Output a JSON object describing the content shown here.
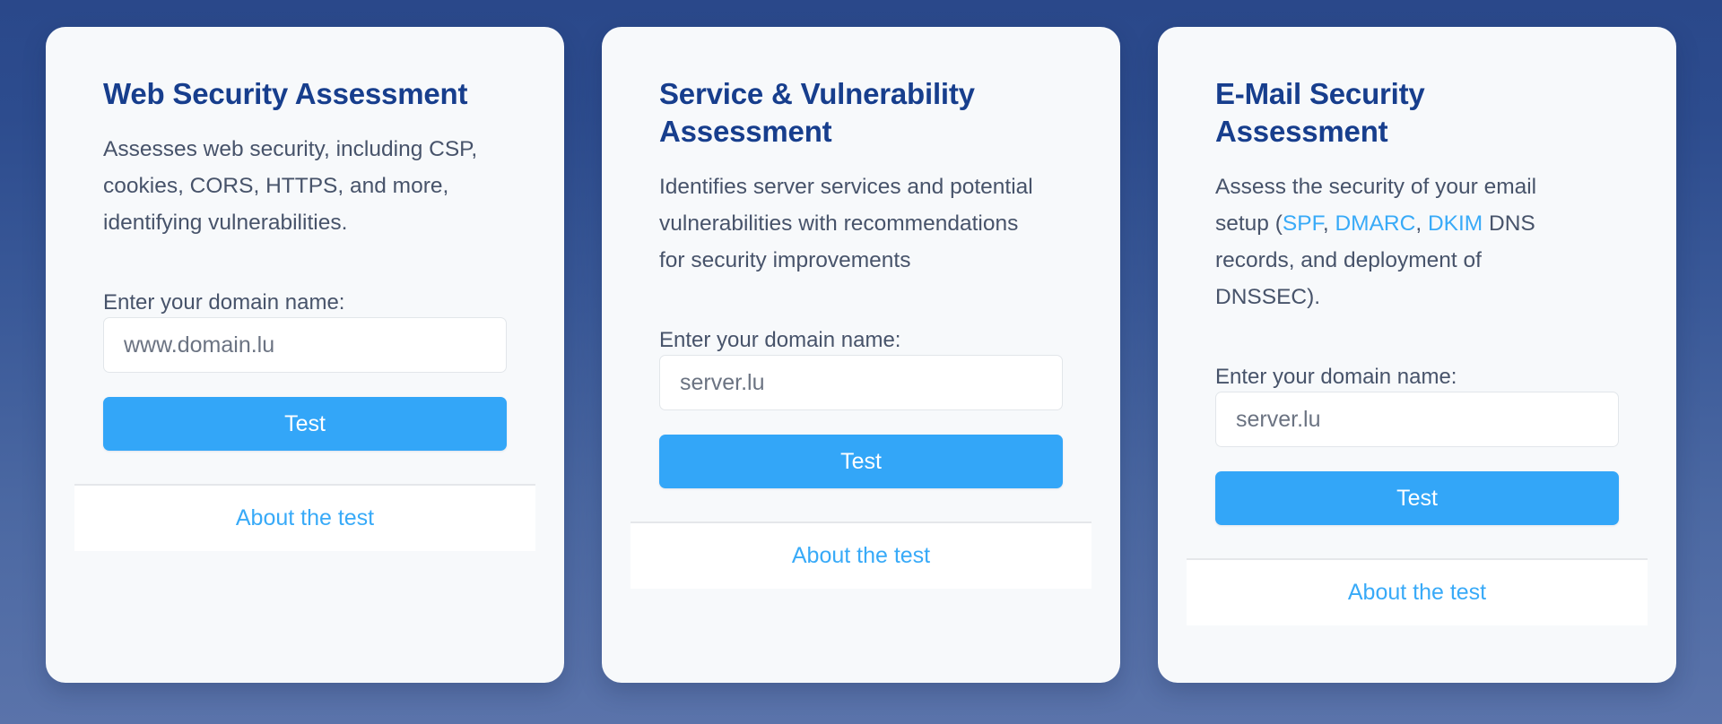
{
  "theme": {
    "background_top": "#2a488a",
    "background_bottom": "#5a73aa",
    "card_background": "#f7f9fb",
    "title_color": "#173e8d",
    "body_text_color": "#47536a",
    "accent_blue": "#33a6f8",
    "link_blue": "#38aaf8"
  },
  "cards": [
    {
      "title": "Web Security Assessment",
      "description": {
        "segments": [
          {
            "text": "Assesses web security, including CSP, cookies, CORS, HTTPS, and more, identifying vulnerabilities.",
            "link": false
          }
        ]
      },
      "field_label": "Enter your domain name:",
      "input_value": "",
      "input_placeholder": "www.domain.lu",
      "button_label": "Test",
      "footer_link_label": "About the test"
    },
    {
      "title": "Service & Vulnerability Assessment",
      "description": {
        "segments": [
          {
            "text": "Identifies server services and potential vulnerabilities with recommendations for security improvements",
            "link": false
          }
        ]
      },
      "field_label": "Enter your domain name:",
      "input_value": "",
      "input_placeholder": "server.lu",
      "button_label": "Test",
      "footer_link_label": "About the test"
    },
    {
      "title": "E-Mail Security Assessment",
      "description": {
        "segments": [
          {
            "text": "Assess the security of your email setup (",
            "link": false
          },
          {
            "text": "SPF",
            "link": true
          },
          {
            "text": ", ",
            "link": false
          },
          {
            "text": "DMARC",
            "link": true
          },
          {
            "text": ", ",
            "link": false
          },
          {
            "text": "DKIM",
            "link": true
          },
          {
            "text": " DNS records, and deployment of DNSSEC).",
            "link": false
          }
        ]
      },
      "field_label": "Enter your domain name:",
      "input_value": "",
      "input_placeholder": "server.lu",
      "button_label": "Test",
      "footer_link_label": "About the test"
    }
  ]
}
